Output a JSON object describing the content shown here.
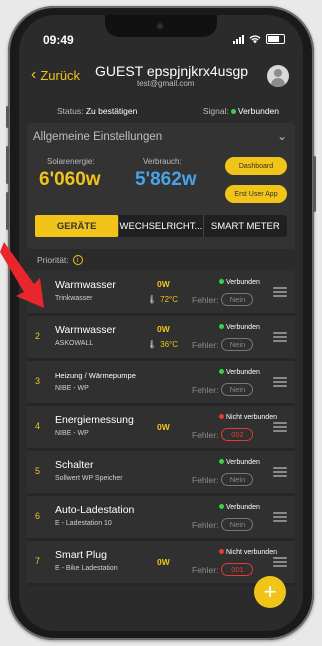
{
  "statusbar": {
    "time": "09:49"
  },
  "header": {
    "back_label": "Zurück",
    "title": "GUEST epspjnjkrx4usgp",
    "email": "test@gmail.com"
  },
  "status_row": {
    "status_label": "Status:",
    "status_value": "Zu bestätigen",
    "signal_label": "Signal:",
    "signal_value": "Verbunden"
  },
  "settings": {
    "title": "Allgemeine Einstellungen",
    "solar_label": "Solarenergie:",
    "solar_value": "6'060w",
    "consumption_label": "Verbrauch:",
    "consumption_value": "5'862w",
    "dashboard_button": "Dashboard",
    "app_button": "Erst User App"
  },
  "tabs": [
    {
      "label": "GERÄTE",
      "active": true
    },
    {
      "label": "WECHSELRICHT...",
      "active": false
    },
    {
      "label": "SMART METER",
      "active": false
    }
  ],
  "priority_label": "Priorität:",
  "devices": [
    {
      "num": "",
      "name": "Warmwasser",
      "sub": "Trinkwasser",
      "power": "0W",
      "temp": "72°C",
      "status": "Verbunden",
      "connected": true,
      "error_label": "Fehler:",
      "error": "Nein"
    },
    {
      "num": "2",
      "name": "Warmwasser",
      "sub": "ASKOWALL",
      "power": "0W",
      "temp": "36°C",
      "status": "Verbunden",
      "connected": true,
      "error_label": "Fehler:",
      "error": "Nein"
    },
    {
      "num": "3",
      "name": "Heizung / Wärmepumpe",
      "sub": "NIBE - WP",
      "power": "",
      "temp": "",
      "status": "Verbunden",
      "connected": true,
      "error_label": "Fehler:",
      "error": "Nein"
    },
    {
      "num": "4",
      "name": "Energiemessung",
      "sub": "NIBE - WP",
      "power": "0W",
      "temp": "",
      "status": "Nicht verbunden",
      "connected": false,
      "error_label": "Fehler:",
      "error": "002"
    },
    {
      "num": "5",
      "name": "Schalter",
      "sub": "Sollwert WP Speicher",
      "power": "",
      "temp": "",
      "status": "Verbunden",
      "connected": true,
      "error_label": "Fehler:",
      "error": "Nein"
    },
    {
      "num": "6",
      "name": "Auto-Ladestation",
      "sub": "E - Ladestation 10",
      "power": "",
      "temp": "",
      "status": "Verbunden",
      "connected": true,
      "error_label": "Fehler:",
      "error": "Nein"
    },
    {
      "num": "7",
      "name": "Smart Plug",
      "sub": "E - Bike Ladestation",
      "power": "0W",
      "temp": "",
      "status": "Nicht verbunden",
      "connected": false,
      "error_label": "Fehler:",
      "error": "001"
    }
  ],
  "fab_label": "+",
  "colors": {
    "accent": "#f0c419",
    "consumption": "#4aa3e8",
    "connected": "#3ccf4e",
    "disconnected": "#e53935",
    "background": "#2b2b2b"
  },
  "icons": {
    "back": "chevron-left-icon",
    "avatar": "user-avatar-icon",
    "expand": "chevron-down-icon",
    "info": "info-icon",
    "temperature": "thermometer-icon",
    "drag": "drag-handle-icon",
    "add": "plus-icon"
  }
}
